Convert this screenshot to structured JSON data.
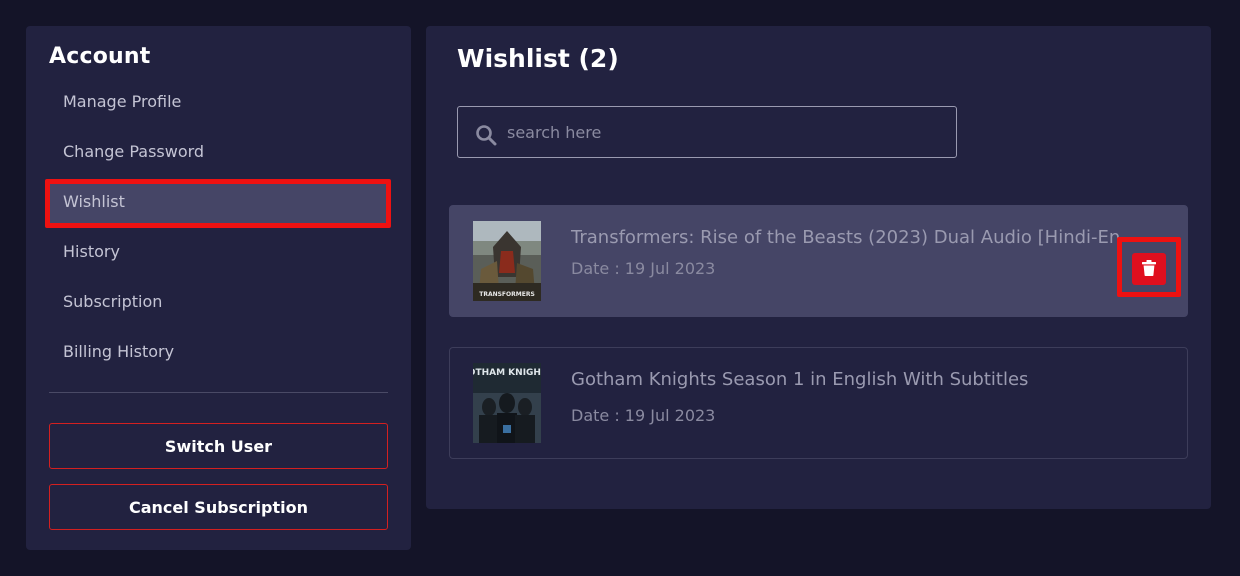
{
  "sidebar": {
    "title": "Account",
    "items": [
      {
        "label": "Manage Profile"
      },
      {
        "label": "Change Password"
      },
      {
        "label": "Wishlist"
      },
      {
        "label": "History"
      },
      {
        "label": "Subscription"
      },
      {
        "label": "Billing History"
      }
    ],
    "switch_user_label": "Switch User",
    "cancel_subscription_label": "Cancel Subscription"
  },
  "main": {
    "title": "Wishlist (2)",
    "search": {
      "placeholder": "search here"
    },
    "items": [
      {
        "title": "Transformers: Rise of the Beasts (2023) Dual Audio [Hindi-En",
        "date": "Date : 19 Jul 2023",
        "poster_caption": "TRANSFORMERS"
      },
      {
        "title": "Gotham Knights Season 1 in English With Subtitles",
        "date": "Date : 19 Jul 2023",
        "poster_caption": "GOTHAM KNIGHTS"
      }
    ]
  },
  "colors": {
    "background": "#141428",
    "panel": "#222240",
    "active_row": "#454566",
    "accent_red": "#e00f1e"
  }
}
